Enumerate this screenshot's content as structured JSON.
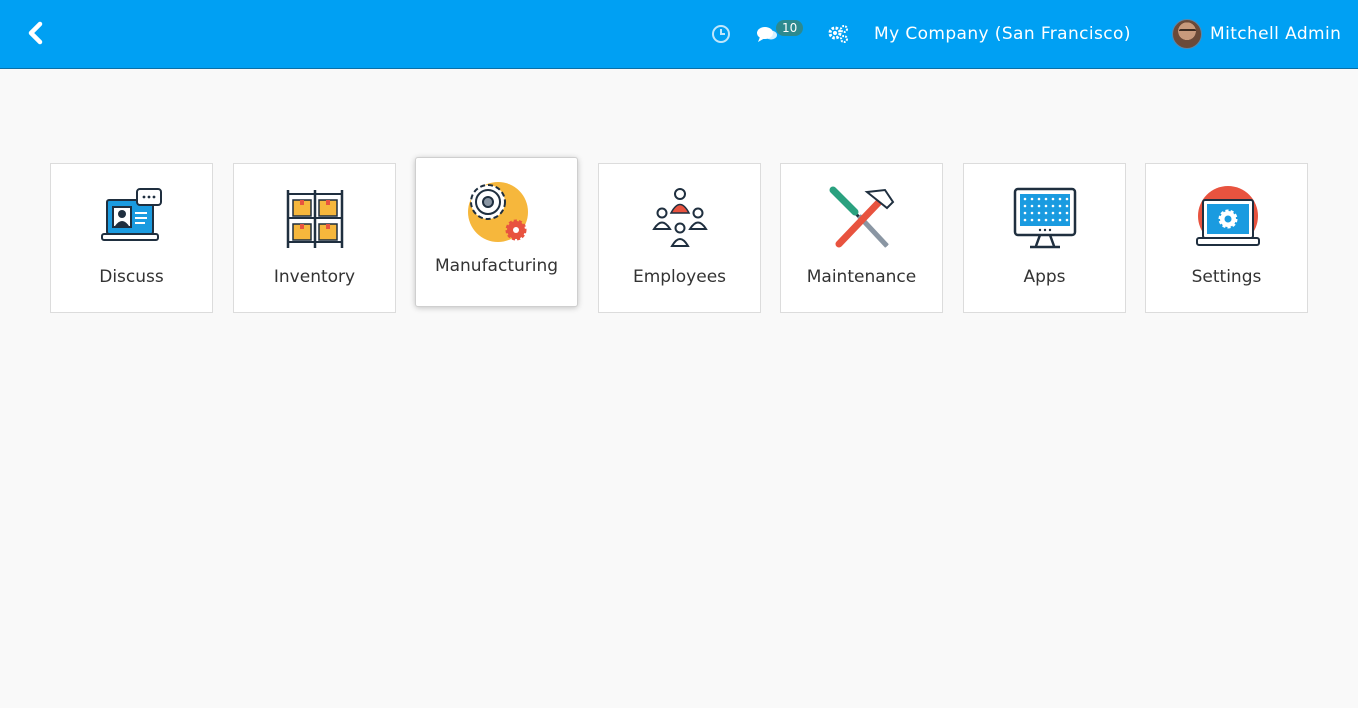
{
  "navbar": {
    "back_icon": "chevron-left-icon",
    "activity_icon": "clock-icon",
    "messages_icon": "chat-icon",
    "messages_count": "10",
    "debug_icon": "gears-icon",
    "company": "My Company (San Francisco)",
    "user_name": "Mitchell Admin",
    "bg_color": "#00a0f3"
  },
  "apps": [
    {
      "label": "Discuss",
      "icon": "discuss-icon"
    },
    {
      "label": "Inventory",
      "icon": "inventory-icon"
    },
    {
      "label": "Manufacturing",
      "icon": "manufacturing-icon"
    },
    {
      "label": "Employees",
      "icon": "employees-icon"
    },
    {
      "label": "Maintenance",
      "icon": "maintenance-icon"
    },
    {
      "label": "Apps",
      "icon": "apps-icon"
    },
    {
      "label": "Settings",
      "icon": "settings-icon"
    }
  ]
}
